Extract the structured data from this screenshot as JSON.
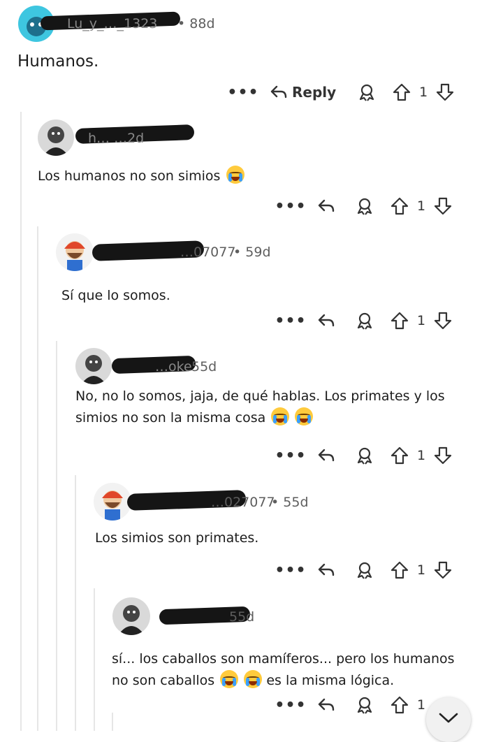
{
  "comments": [
    {
      "username_visible": "Lu_y_…_1323",
      "age": "88d",
      "text": "Humanos.",
      "reply_label": "Reply",
      "score": "1"
    },
    {
      "username_visible": "h… …2d",
      "age": "",
      "text": "Los humanos no son simios",
      "score": "1"
    },
    {
      "username_visible": "…07077",
      "age": "59d",
      "text": "Sí que lo somos.",
      "score": "1"
    },
    {
      "username_visible": "…oke",
      "age": "55d",
      "text": "No, no lo somos, jaja, de qué hablas. Los primates y los simios no son la misma cosa",
      "score": "1"
    },
    {
      "username_visible": "…027077",
      "age": "55d",
      "text": "Los simios son primates.",
      "score": "1"
    },
    {
      "username_visible": "…",
      "age": "55d",
      "text_a": "sí... los caballos son mamíferos... pero los humanos no son caballos",
      "text_b": "es la misma lógica.",
      "score": "1"
    }
  ],
  "separator": "•",
  "more_options": "•••",
  "icons": [
    "more-icon",
    "reply-icon",
    "award-icon",
    "upvote-icon",
    "downvote-icon",
    "chevron-down-icon"
  ],
  "colors": {
    "thread_line": "#e6e6e6",
    "text": "#1c1c1c",
    "meta": "#5e5e5e",
    "redaction": "#151515"
  }
}
